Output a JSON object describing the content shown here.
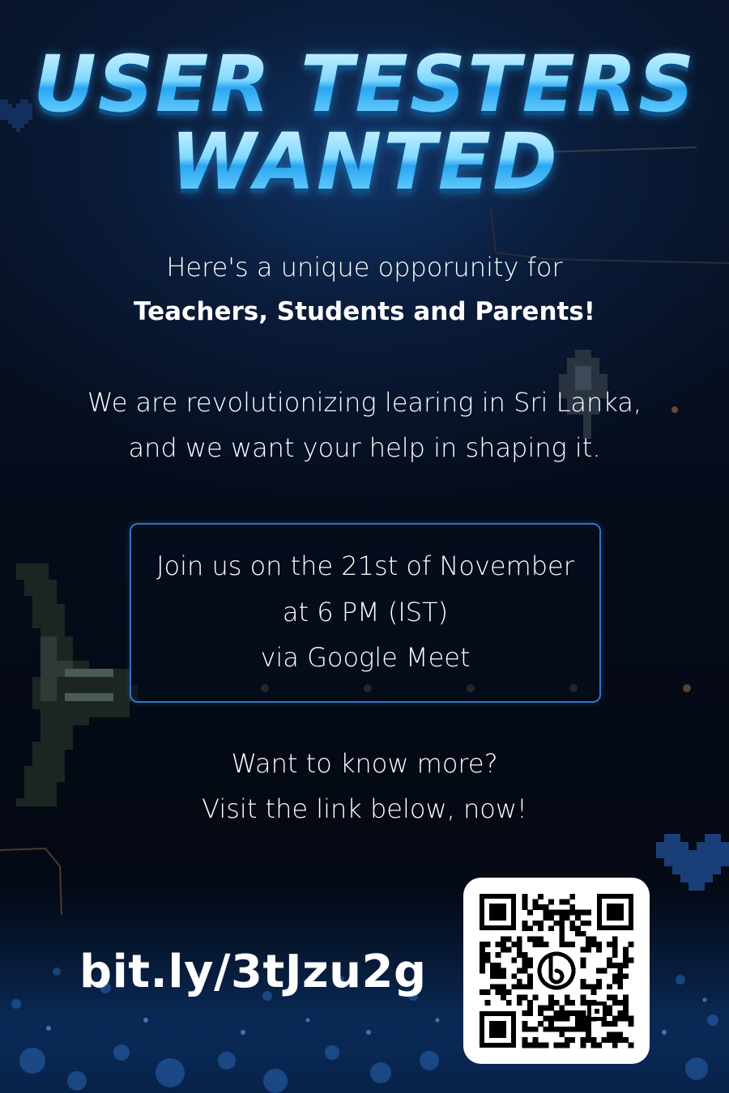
{
  "title": {
    "line1": "USER TESTERS",
    "line2": "WANTED"
  },
  "intro": {
    "line1": "Here's a unique opporunity for",
    "line2": "Teachers, Students and Parents!"
  },
  "mission": {
    "line1": "We are revolutionizing learing in Sri Lanka,",
    "line2": "and we want your help in shaping it."
  },
  "event": {
    "line1": "Join us on the 21st of November",
    "line2": "at 6 PM (IST)",
    "line3": "via Google Meet"
  },
  "more": {
    "line1": "Want to know more?",
    "line2": "Visit the link below, now!"
  },
  "link": "bit.ly/3tJzu2g",
  "colors": {
    "title_fill": "#7fd8ff",
    "card_border": "#2e74c4",
    "background": "#050a16"
  },
  "icons": [
    "pixel-heart-icon",
    "pixel-spaceship-icon",
    "qr-code",
    "bitly-logo"
  ]
}
